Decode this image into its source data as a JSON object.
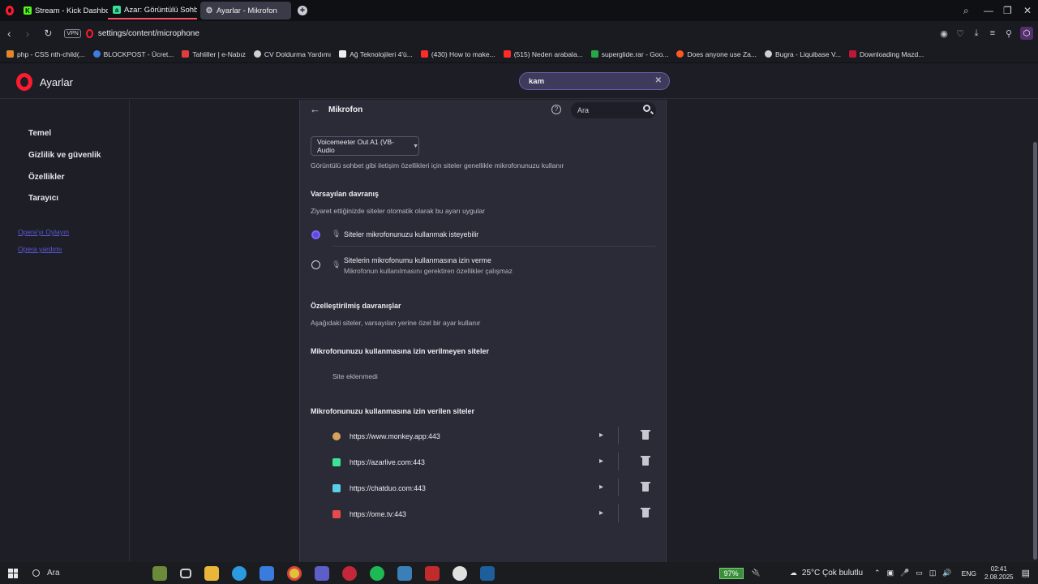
{
  "tabs": [
    {
      "title": "Stream - Kick Dashboard",
      "icon": "kick-icon",
      "color": "#53fc18"
    },
    {
      "title": "Azar: Görüntülü Sohbet, A",
      "icon": "azar-icon",
      "color": "#38e09a"
    },
    {
      "title": "Ayarlar - Mikrofon",
      "icon": "gear-icon",
      "color": "#c9cbd5"
    }
  ],
  "address": {
    "vpn": "VPN",
    "url": "settings/content/microphone"
  },
  "bookmarks": [
    {
      "label": "php - CSS nth-child(...",
      "color": "#e2862d"
    },
    {
      "label": "BLOCKPOST - Ücret...",
      "color": "#3d7de0"
    },
    {
      "label": "Tahliller | e-Nabız",
      "color": "#e03d3d"
    },
    {
      "label": "CV Doldurma Yardımı",
      "color": "#d0d0d0"
    },
    {
      "label": "Ağ Teknolojileri 4'ü...",
      "color": "#eeeeee"
    },
    {
      "label": "(430) How to make...",
      "color": "#ff2b2b"
    },
    {
      "label": "(515) Neden arabala...",
      "color": "#ff2b2b"
    },
    {
      "label": "superglide.rar - Goo...",
      "color": "#28a745"
    },
    {
      "label": "Does anyone use Za...",
      "color": "#ff5722"
    },
    {
      "label": "Bugra - Liquibase V...",
      "color": "#d0d0d0"
    },
    {
      "label": "Downloading Mazd...",
      "color": "#c0163a"
    }
  ],
  "header": {
    "title": "Ayarlar",
    "search_value": "kam"
  },
  "sidebar": {
    "items": [
      "Temel",
      "Gizlilik ve güvenlik",
      "Özellikler",
      "Tarayıcı"
    ],
    "links": [
      "Opera'yı Oylayın",
      "Opera yardımı"
    ]
  },
  "panel": {
    "title": "Mikrofon",
    "search_placeholder": "Ara",
    "device": "Voicemeeter Out A1 (VB-Audio",
    "device_desc": "Görüntülü sohbet gibi iletişim özellikleri için siteler genellikle mikrofonunuzu kullanır",
    "default_title": "Varsayılan davranış",
    "default_desc": "Ziyaret ettiğinizde siteler otomatik olarak bu ayarı uygular",
    "option_allow": "Siteler mikrofonunuzu kullanmak isteyebilir",
    "option_block": "Sitelerin mikrofonumu kullanmasına izin verme",
    "option_block_sub": "Mikrofonun kullanılmasını gerektiren özellikler çalışmaz",
    "custom_title": "Özelleştirilmiş davranışlar",
    "custom_desc": "Aşağıdaki siteler, varsayılan yerine özel bir ayar kullanır",
    "blocked_title": "Mikrofonunuzu kullanmasına izin verilmeyen siteler",
    "blocked_empty": "Site eklenmedi",
    "allowed_title": "Mikrofonunuzu kullanmasına izin verilen siteler",
    "allowed_sites": [
      {
        "url": "https://www.monkey.app:443",
        "color": "#d9a25a"
      },
      {
        "url": "https://azarlive.com:443",
        "color": "#3ee39a"
      },
      {
        "url": "https://chatduo.com:443",
        "color": "#5ccde8"
      },
      {
        "url": "https://ome.tv:443",
        "color": "#e84a4a"
      }
    ]
  },
  "taskbar": {
    "search": "Ara",
    "battery": "97%",
    "weather": "25°C  Çok bulutlu",
    "lang": "ENG",
    "time": "02:41",
    "date": "2.08.2025"
  }
}
